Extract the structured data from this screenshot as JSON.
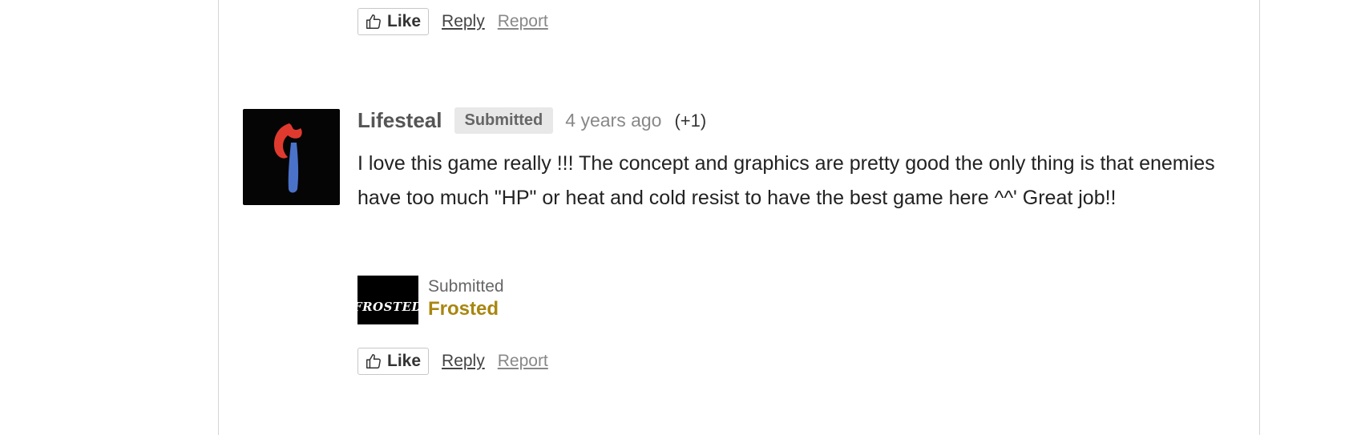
{
  "comments": [
    {
      "actions": {
        "like_label": "Like",
        "reply_label": "Reply",
        "report_label": "Report"
      }
    },
    {
      "author": "Lifesteal",
      "badge": "Submitted",
      "time": "4 years ago",
      "votes": "(+1)",
      "text": "I love this game really !!! The concept and graphics are pretty good the only thing is that enemies have too much \"HP\" or heat and cold resist to have the best game here ^^' Great job!!",
      "submission": {
        "label": "Submitted",
        "game_title": "Frosted",
        "thumb_text": "FROSTED"
      },
      "actions": {
        "like_label": "Like",
        "reply_label": "Reply",
        "report_label": "Report"
      }
    }
  ],
  "icons": {
    "like": "thumbs-up-icon",
    "avatar": "red-blue-j-logo"
  },
  "colors": {
    "game_link": "#a8860f",
    "badge_bg": "#e8e8e8",
    "avatar_red": "#e03a2f",
    "avatar_blue": "#4a72c8"
  }
}
